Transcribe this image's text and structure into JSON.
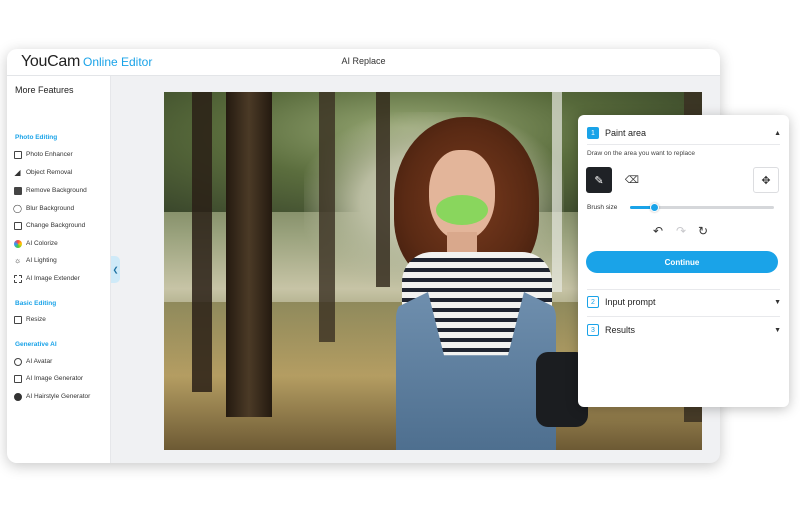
{
  "app": {
    "brand": "YouCam",
    "brand_sub": "Online Editor",
    "title": "AI Replace"
  },
  "sidebar": {
    "title": "More Features",
    "sections": [
      {
        "label": "Photo Editing",
        "items": [
          {
            "label": "Photo Enhancer",
            "icon": "photo-enhancer-icon"
          },
          {
            "label": "Object Removal",
            "icon": "eraser-icon"
          },
          {
            "label": "Remove Background",
            "icon": "remove-background-icon"
          },
          {
            "label": "Blur Background",
            "icon": "blur-drop-icon"
          },
          {
            "label": "Change Background",
            "icon": "change-background-icon"
          },
          {
            "label": "AI Colorize",
            "icon": "color-wheel-icon"
          },
          {
            "label": "AI Lighting",
            "icon": "lightbulb-icon"
          },
          {
            "label": "AI Image Extender",
            "icon": "expand-icon"
          }
        ]
      },
      {
        "label": "Basic Editing",
        "items": [
          {
            "label": "Resize",
            "icon": "resize-icon"
          }
        ]
      },
      {
        "label": "Generative AI",
        "items": [
          {
            "label": "AI Avatar",
            "icon": "avatar-icon"
          },
          {
            "label": "AI Image Generator",
            "icon": "image-generator-icon"
          },
          {
            "label": "AI Hairstyle Generator",
            "icon": "hairstyle-icon"
          }
        ]
      }
    ]
  },
  "panel": {
    "steps": [
      {
        "num": "1",
        "label": "Paint area",
        "expanded": true
      },
      {
        "num": "2",
        "label": "Input prompt",
        "expanded": false
      },
      {
        "num": "3",
        "label": "Results",
        "expanded": false
      }
    ],
    "hint": "Draw on the area you want to replace",
    "brush_label": "Brush size",
    "brush_value": 0.17,
    "continue_label": "Continue",
    "accent": "#1aa3e8",
    "mask_color": "#7ed957"
  }
}
